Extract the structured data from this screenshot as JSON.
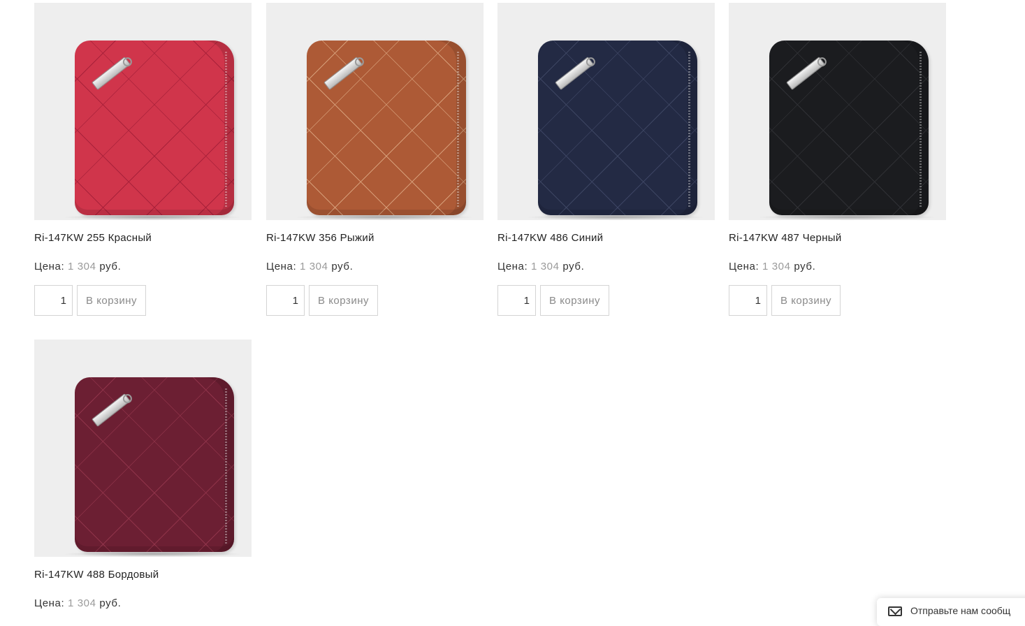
{
  "products": [
    {
      "name": "Ri-147KW 255 Красный",
      "price_label": "Цена:",
      "price_value": "1 304",
      "currency": "руб.",
      "quantity": "1",
      "cart_button": "В корзину",
      "color": "#d0354b",
      "stitch_color": "#a8213a"
    },
    {
      "name": "Ri-147KW 356 Рыжий",
      "price_label": "Цена:",
      "price_value": "1 304",
      "currency": "руб.",
      "quantity": "1",
      "cart_button": "В корзину",
      "color": "#ad5a36",
      "stitch_color": "#d59c77"
    },
    {
      "name": "Ri-147KW 486 Синий",
      "price_label": "Цена:",
      "price_value": "1 304",
      "currency": "руб.",
      "quantity": "1",
      "cart_button": "В корзину",
      "color": "#232a44",
      "stitch_color": "#3c4462"
    },
    {
      "name": "Ri-147KW 487 Черный",
      "price_label": "Цена:",
      "price_value": "1 304",
      "currency": "руб.",
      "quantity": "1",
      "cart_button": "В корзину",
      "color": "#1b1c1f",
      "stitch_color": "#2f3034"
    },
    {
      "name": "Ri-147KW 488 Бордовый",
      "price_label": "Цена:",
      "price_value": "1 304",
      "currency": "руб.",
      "quantity": "1",
      "cart_button": "В корзину",
      "color": "#6c1f33",
      "stitch_color": "#8f3349"
    }
  ],
  "feedback_widget": {
    "label": "Отправьте нам сообщ",
    "icon": "mail-icon"
  }
}
